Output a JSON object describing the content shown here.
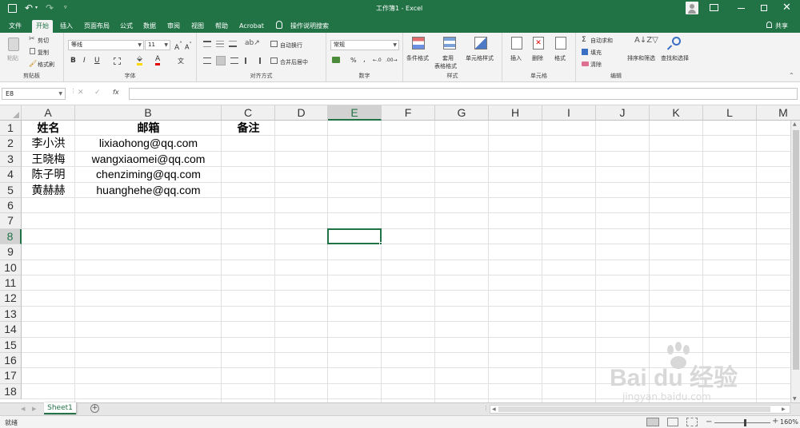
{
  "window": {
    "title": "工作簿1 - Excel",
    "user_icon": "user-avatar",
    "qat_icons": [
      "save-icon",
      "undo-icon",
      "redo-icon",
      "customize-icon"
    ]
  },
  "ribbon_tabs": [
    "文件",
    "开始",
    "插入",
    "页面布局",
    "公式",
    "数据",
    "审阅",
    "视图",
    "帮助",
    "Acrobat"
  ],
  "active_tab": "开始",
  "tell_me": "操作说明搜索",
  "share": "共享",
  "clipboard": {
    "paste": "粘贴",
    "cut": "剪切",
    "copy": "复制",
    "format_painter": "格式刷",
    "label": "剪贴板"
  },
  "font": {
    "name": "等线",
    "size": "11",
    "bold": "B",
    "italic": "I",
    "underline": "U",
    "label": "字体"
  },
  "alignment": {
    "wrap": "自动换行",
    "merge": "合并后居中",
    "label": "对齐方式"
  },
  "number": {
    "format": "常规",
    "label": "数字"
  },
  "styles": {
    "conditional": "条件格式",
    "table_l1": "套用",
    "table_l2": "表格格式",
    "cell_styles": "单元格样式",
    "label": "样式"
  },
  "cells": {
    "insert": "插入",
    "delete": "删除",
    "format": "格式",
    "label": "单元格"
  },
  "editing": {
    "autosum": "自动求和",
    "fill": "填充",
    "clear": "清除",
    "sort": "排序和筛选",
    "find": "查找和选择",
    "label": "编辑"
  },
  "formula_bar": {
    "name_box": "E8",
    "fx": "fx",
    "value": ""
  },
  "columns": [
    "A",
    "B",
    "C",
    "D",
    "E",
    "F",
    "G",
    "H",
    "I",
    "J",
    "K",
    "L",
    "M"
  ],
  "rows": [
    "1",
    "2",
    "3",
    "4",
    "5",
    "6",
    "7",
    "8",
    "9",
    "10",
    "11",
    "12",
    "13",
    "14",
    "15",
    "16",
    "17",
    "18"
  ],
  "selected_cell": "E8",
  "cells_data": [
    {
      "a": "姓名",
      "b": "邮箱",
      "c": "备注"
    },
    {
      "a": "李小洪",
      "b": "lixiaohong@qq.com",
      "c": ""
    },
    {
      "a": "王晓梅",
      "b": "wangxiaomei@qq.com",
      "c": ""
    },
    {
      "a": "陈子明",
      "b": "chenziming@qq.com",
      "c": ""
    },
    {
      "a": "黄赫赫",
      "b": "huanghehe@qq.com",
      "c": ""
    }
  ],
  "sheet_tabs": [
    "Sheet1"
  ],
  "status": {
    "ready": "就绪",
    "zoom": "160%"
  },
  "watermark": {
    "brand": "Bai du 经验",
    "url": "jingyan.baidu.com"
  },
  "colors": {
    "excel_green": "#217346",
    "ribbon_bg": "#f3f3f3",
    "selection": "#217346"
  }
}
